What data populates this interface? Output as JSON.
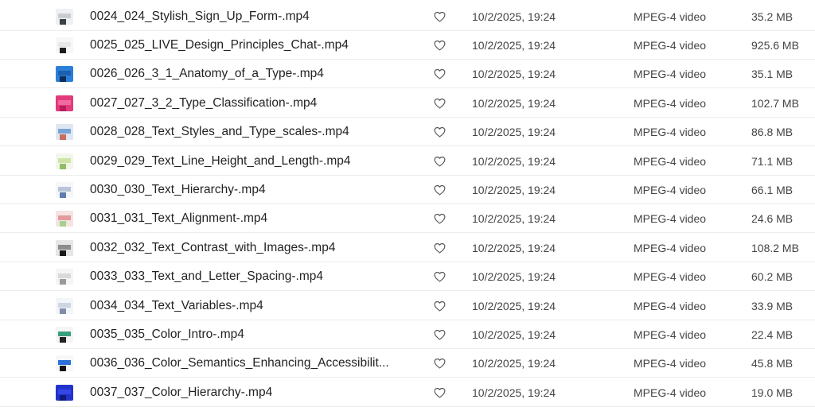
{
  "rows": [
    {
      "name": "0024_024_Stylish_Sign_Up_Form-.mp4",
      "date": "10/2/2025, 19:24",
      "kind": "MPEG-4 video",
      "size": "35.2 MB",
      "thumb": [
        "#eef0f2",
        "#c9ccd1",
        "#3a3f48"
      ]
    },
    {
      "name": "0025_025_LIVE_Design_Principles_Chat-.mp4",
      "date": "10/2/2025, 19:24",
      "kind": "MPEG-4 video",
      "size": "925.6 MB",
      "thumb": [
        "#f7f7f7",
        "#e8e8e8",
        "#1e1e1e"
      ]
    },
    {
      "name": "0026_026_3_1_Anatomy_of_a_Type-.mp4",
      "date": "10/2/2025, 19:24",
      "kind": "MPEG-4 video",
      "size": "35.1 MB",
      "thumb": [
        "#2c7fd9",
        "#1b5fae",
        "#0c2c5c"
      ]
    },
    {
      "name": "0027_027_3_2_Type_Classification-.mp4",
      "date": "10/2/2025, 19:24",
      "kind": "MPEG-4 video",
      "size": "102.7 MB",
      "thumb": [
        "#e23a7a",
        "#f06aa0",
        "#b81d5c"
      ]
    },
    {
      "name": "0028_028_Text_Styles_and_Type_scales-.mp4",
      "date": "10/2/2025, 19:24",
      "kind": "MPEG-4 video",
      "size": "86.8 MB",
      "thumb": [
        "#dfe7f3",
        "#7aa4d6",
        "#c86e5a"
      ]
    },
    {
      "name": "0029_029_Text_Line_Height_and_Length-.mp4",
      "date": "10/2/2025, 19:24",
      "kind": "MPEG-4 video",
      "size": "71.1 MB",
      "thumb": [
        "#f3f6ea",
        "#cfe3a8",
        "#8fbf63"
      ]
    },
    {
      "name": "0030_030_Text_Hierarchy-.mp4",
      "date": "10/2/2025, 19:24",
      "kind": "MPEG-4 video",
      "size": "66.1 MB",
      "thumb": [
        "#f4f6f9",
        "#b9c6da",
        "#5d7db0"
      ]
    },
    {
      "name": "0031_031_Text_Alignment-.mp4",
      "date": "10/2/2025, 19:24",
      "kind": "MPEG-4 video",
      "size": "24.6 MB",
      "thumb": [
        "#f6e3e3",
        "#e29a9a",
        "#a6d08f"
      ]
    },
    {
      "name": "0032_032_Text_Contrast_with_Images-.mp4",
      "date": "10/2/2025, 19:24",
      "kind": "MPEG-4 video",
      "size": "108.2 MB",
      "thumb": [
        "#e6e6e6",
        "#8c8c8c",
        "#1a1a1a"
      ]
    },
    {
      "name": "0033_033_Text_and_Letter_Spacing-.mp4",
      "date": "10/2/2025, 19:24",
      "kind": "MPEG-4 video",
      "size": "60.2 MB",
      "thumb": [
        "#f5f5f5",
        "#d9d9d9",
        "#9a9a9a"
      ]
    },
    {
      "name": "0034_034_Text_Variables-.mp4",
      "date": "10/2/2025, 19:24",
      "kind": "MPEG-4 video",
      "size": "33.9 MB",
      "thumb": [
        "#f3f5f8",
        "#cdd6e3",
        "#7f8fa8"
      ]
    },
    {
      "name": "0035_035_Color_Intro-.mp4",
      "date": "10/2/2025, 19:24",
      "kind": "MPEG-4 video",
      "size": "22.4 MB",
      "thumb": [
        "#f5f5f5",
        "#3aa07a",
        "#222222"
      ]
    },
    {
      "name": "0036_036_Color_Semantics_Enhancing_Accessibilit...",
      "date": "10/2/2025, 19:24",
      "kind": "MPEG-4 video",
      "size": "45.8 MB",
      "thumb": [
        "#f7f7f7",
        "#2b6fd8",
        "#151515"
      ]
    },
    {
      "name": "0037_037_Color_Hierarchy-.mp4",
      "date": "10/2/2025, 19:24",
      "kind": "MPEG-4 video",
      "size": "19.0 MB",
      "thumb": [
        "#2233cc",
        "#3546e6",
        "#101a7a"
      ]
    }
  ]
}
